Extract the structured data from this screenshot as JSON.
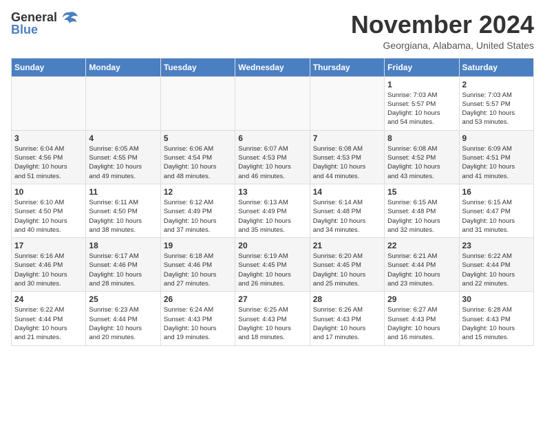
{
  "header": {
    "logo_general": "General",
    "logo_blue": "Blue",
    "month_title": "November 2024",
    "location": "Georgiana, Alabama, United States"
  },
  "calendar": {
    "days_of_week": [
      "Sunday",
      "Monday",
      "Tuesday",
      "Wednesday",
      "Thursday",
      "Friday",
      "Saturday"
    ],
    "weeks": [
      [
        {
          "day": "",
          "info": ""
        },
        {
          "day": "",
          "info": ""
        },
        {
          "day": "",
          "info": ""
        },
        {
          "day": "",
          "info": ""
        },
        {
          "day": "",
          "info": ""
        },
        {
          "day": "1",
          "info": "Sunrise: 7:03 AM\nSunset: 5:57 PM\nDaylight: 10 hours\nand 54 minutes."
        },
        {
          "day": "2",
          "info": "Sunrise: 7:03 AM\nSunset: 5:57 PM\nDaylight: 10 hours\nand 53 minutes."
        }
      ],
      [
        {
          "day": "3",
          "info": "Sunrise: 6:04 AM\nSunset: 4:56 PM\nDaylight: 10 hours\nand 51 minutes."
        },
        {
          "day": "4",
          "info": "Sunrise: 6:05 AM\nSunset: 4:55 PM\nDaylight: 10 hours\nand 49 minutes."
        },
        {
          "day": "5",
          "info": "Sunrise: 6:06 AM\nSunset: 4:54 PM\nDaylight: 10 hours\nand 48 minutes."
        },
        {
          "day": "6",
          "info": "Sunrise: 6:07 AM\nSunset: 4:53 PM\nDaylight: 10 hours\nand 46 minutes."
        },
        {
          "day": "7",
          "info": "Sunrise: 6:08 AM\nSunset: 4:53 PM\nDaylight: 10 hours\nand 44 minutes."
        },
        {
          "day": "8",
          "info": "Sunrise: 6:08 AM\nSunset: 4:52 PM\nDaylight: 10 hours\nand 43 minutes."
        },
        {
          "day": "9",
          "info": "Sunrise: 6:09 AM\nSunset: 4:51 PM\nDaylight: 10 hours\nand 41 minutes."
        }
      ],
      [
        {
          "day": "10",
          "info": "Sunrise: 6:10 AM\nSunset: 4:50 PM\nDaylight: 10 hours\nand 40 minutes."
        },
        {
          "day": "11",
          "info": "Sunrise: 6:11 AM\nSunset: 4:50 PM\nDaylight: 10 hours\nand 38 minutes."
        },
        {
          "day": "12",
          "info": "Sunrise: 6:12 AM\nSunset: 4:49 PM\nDaylight: 10 hours\nand 37 minutes."
        },
        {
          "day": "13",
          "info": "Sunrise: 6:13 AM\nSunset: 4:49 PM\nDaylight: 10 hours\nand 35 minutes."
        },
        {
          "day": "14",
          "info": "Sunrise: 6:14 AM\nSunset: 4:48 PM\nDaylight: 10 hours\nand 34 minutes."
        },
        {
          "day": "15",
          "info": "Sunrise: 6:15 AM\nSunset: 4:48 PM\nDaylight: 10 hours\nand 32 minutes."
        },
        {
          "day": "16",
          "info": "Sunrise: 6:15 AM\nSunset: 4:47 PM\nDaylight: 10 hours\nand 31 minutes."
        }
      ],
      [
        {
          "day": "17",
          "info": "Sunrise: 6:16 AM\nSunset: 4:46 PM\nDaylight: 10 hours\nand 30 minutes."
        },
        {
          "day": "18",
          "info": "Sunrise: 6:17 AM\nSunset: 4:46 PM\nDaylight: 10 hours\nand 28 minutes."
        },
        {
          "day": "19",
          "info": "Sunrise: 6:18 AM\nSunset: 4:46 PM\nDaylight: 10 hours\nand 27 minutes."
        },
        {
          "day": "20",
          "info": "Sunrise: 6:19 AM\nSunset: 4:45 PM\nDaylight: 10 hours\nand 26 minutes."
        },
        {
          "day": "21",
          "info": "Sunrise: 6:20 AM\nSunset: 4:45 PM\nDaylight: 10 hours\nand 25 minutes."
        },
        {
          "day": "22",
          "info": "Sunrise: 6:21 AM\nSunset: 4:44 PM\nDaylight: 10 hours\nand 23 minutes."
        },
        {
          "day": "23",
          "info": "Sunrise: 6:22 AM\nSunset: 4:44 PM\nDaylight: 10 hours\nand 22 minutes."
        }
      ],
      [
        {
          "day": "24",
          "info": "Sunrise: 6:22 AM\nSunset: 4:44 PM\nDaylight: 10 hours\nand 21 minutes."
        },
        {
          "day": "25",
          "info": "Sunrise: 6:23 AM\nSunset: 4:44 PM\nDaylight: 10 hours\nand 20 minutes."
        },
        {
          "day": "26",
          "info": "Sunrise: 6:24 AM\nSunset: 4:43 PM\nDaylight: 10 hours\nand 19 minutes."
        },
        {
          "day": "27",
          "info": "Sunrise: 6:25 AM\nSunset: 4:43 PM\nDaylight: 10 hours\nand 18 minutes."
        },
        {
          "day": "28",
          "info": "Sunrise: 6:26 AM\nSunset: 4:43 PM\nDaylight: 10 hours\nand 17 minutes."
        },
        {
          "day": "29",
          "info": "Sunrise: 6:27 AM\nSunset: 4:43 PM\nDaylight: 10 hours\nand 16 minutes."
        },
        {
          "day": "30",
          "info": "Sunrise: 6:28 AM\nSunset: 4:43 PM\nDaylight: 10 hours\nand 15 minutes."
        }
      ]
    ]
  }
}
